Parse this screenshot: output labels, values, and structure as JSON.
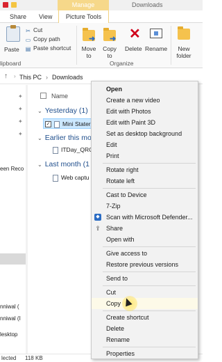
{
  "window": {
    "context_tab": "Manage",
    "title": "Downloads"
  },
  "ribbon_tabs": [
    "Share",
    "View",
    "Picture Tools"
  ],
  "ribbon": {
    "clipboard": {
      "paste": "Paste",
      "cut": "Cut",
      "copy_path": "Copy path",
      "paste_shortcut": "Paste shortcut",
      "group_label": "lipboard"
    },
    "organize": {
      "move_to": "Move to",
      "copy_to": "Copy to",
      "delete": "Delete",
      "rename": "Rename",
      "group_label": "Organize"
    },
    "new": {
      "new_folder": "New folder"
    }
  },
  "address": {
    "root": "This PC",
    "folder": "Downloads"
  },
  "nav": {
    "items": [
      "een Reco",
      "nniwal (",
      "nniwal (I",
      "lesktop"
    ]
  },
  "list": {
    "column_name": "Name",
    "groups": [
      {
        "label": "Yesterday (1)"
      },
      {
        "label": "Earlier this mo"
      },
      {
        "label": "Last month (1"
      }
    ],
    "files": [
      {
        "name": "Mini Stater",
        "selected": true
      },
      {
        "name": "ITDay_QRC",
        "selected": false
      },
      {
        "name": "Web captu",
        "selected": false
      }
    ]
  },
  "status": {
    "selection": "lected",
    "size": "118 KB"
  },
  "context_menu": {
    "items": [
      {
        "label": "Open",
        "bold": true
      },
      {
        "label": "Create a new video"
      },
      {
        "label": "Edit with Photos"
      },
      {
        "label": "Edit with Paint 3D"
      },
      {
        "label": "Set as desktop background"
      },
      {
        "label": "Edit"
      },
      {
        "label": "Print"
      },
      {
        "label": "Rotate right"
      },
      {
        "label": "Rotate left"
      },
      {
        "label": "Cast to Device"
      },
      {
        "label": "7-Zip"
      },
      {
        "label": "Scan with Microsoft Defender..."
      },
      {
        "label": "Share"
      },
      {
        "label": "Open with"
      },
      {
        "label": "Give access to"
      },
      {
        "label": "Restore previous versions"
      },
      {
        "label": "Send to"
      },
      {
        "label": "Cut"
      },
      {
        "label": "Copy"
      },
      {
        "label": "Create shortcut"
      },
      {
        "label": "Delete"
      },
      {
        "label": "Rename"
      },
      {
        "label": "Properties"
      }
    ]
  }
}
